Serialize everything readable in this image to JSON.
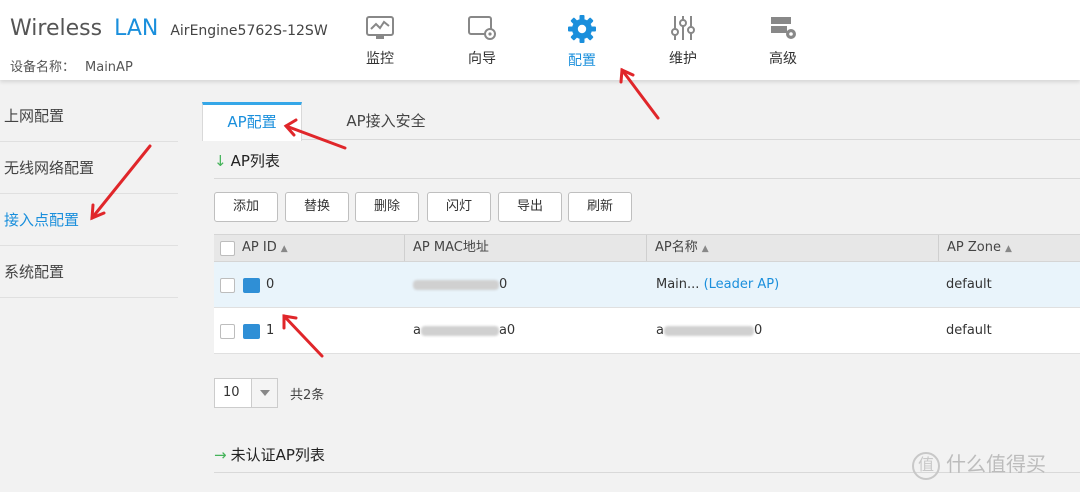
{
  "header": {
    "brand_wireless": "Wireless",
    "brand_lan": "LAN",
    "model": "AirEngine5762S-12SW",
    "device_name_label": "设备名称：",
    "device_name_value": "MainAP",
    "nav": [
      {
        "label": "监控",
        "icon": "monitor-icon"
      },
      {
        "label": "向导",
        "icon": "wizard-icon"
      },
      {
        "label": "配置",
        "icon": "gear-icon",
        "active": true
      },
      {
        "label": "维护",
        "icon": "sliders-icon"
      },
      {
        "label": "高级",
        "icon": "server-gear-icon"
      }
    ]
  },
  "sidebar": {
    "items": [
      {
        "label": "上网配置"
      },
      {
        "label": "无线网络配置"
      },
      {
        "label": "接入点配置",
        "active": true
      },
      {
        "label": "系统配置"
      }
    ]
  },
  "main": {
    "tabs": [
      {
        "label": "AP配置",
        "active": true
      },
      {
        "label": "AP接入安全"
      }
    ],
    "ap_list_title": "AP列表",
    "buttons": [
      "添加",
      "替换",
      "删除",
      "闪灯",
      "导出",
      "刷新"
    ],
    "table": {
      "headers": [
        "AP ID",
        "AP MAC地址",
        "AP名称",
        "AP Zone"
      ],
      "rows": [
        {
          "id": "0",
          "mac_suffix": "0",
          "name": "Main...",
          "name_tag": "(Leader AP)",
          "zone": "default",
          "selected": true
        },
        {
          "id": "1",
          "mac_prefix": "a",
          "mac_suffix": "a0",
          "name_prefix": "a",
          "name_suffix": "0",
          "zone": "default"
        }
      ]
    },
    "page_size": "10",
    "total": "共2条",
    "unauth_title": "未认证AP列表"
  },
  "watermark": {
    "logo_char": "值",
    "text": "什么值得买"
  },
  "colors": {
    "accent": "#1a8fdc",
    "tab_border": "#35a7e8",
    "arrow_green": "#45b35a",
    "annotation_red": "#e0262a"
  }
}
